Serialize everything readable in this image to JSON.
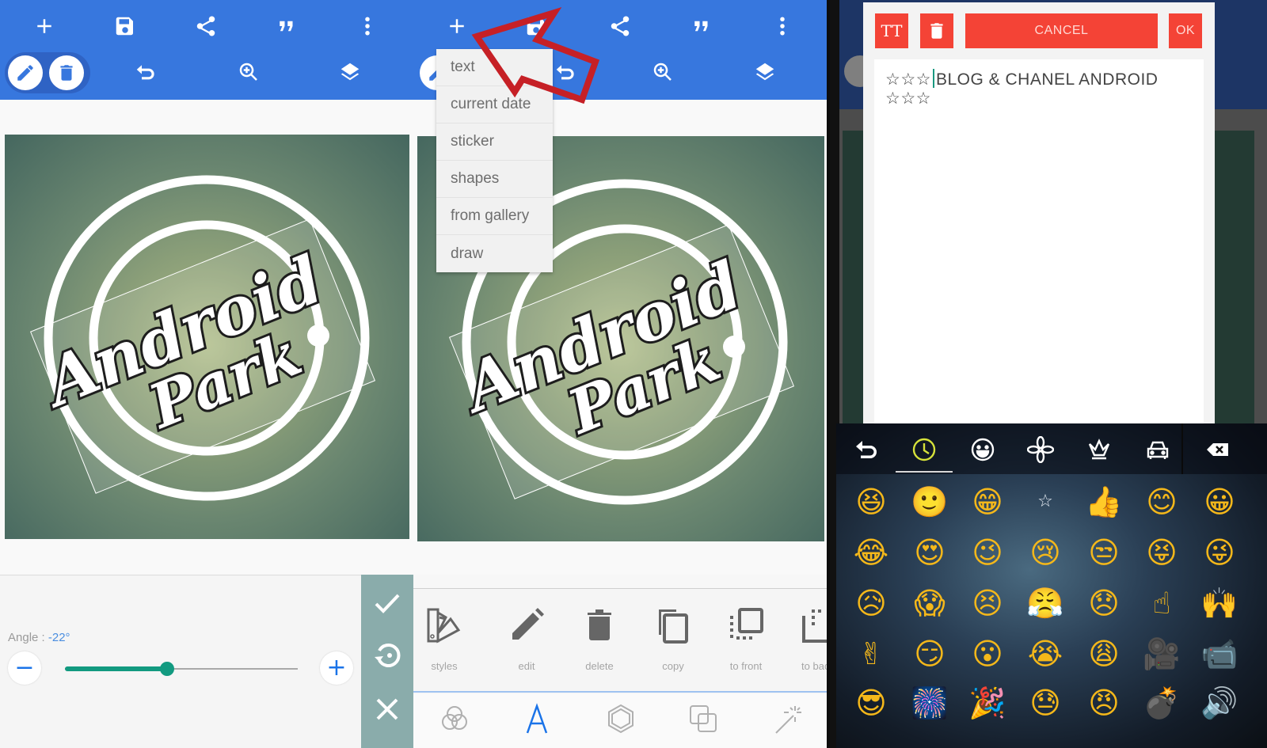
{
  "colors": {
    "appbar": "#3777de",
    "accent_teal": "#129a80",
    "angle_value": "#4a8ee0",
    "dialog_red": "#f44336",
    "action_sidebar": "#8aacab",
    "recent_tab_active": "#d6e23a"
  },
  "panel1": {
    "toolbar_top": [
      {
        "icon": "plus-icon",
        "label": "add"
      },
      {
        "icon": "save-icon",
        "label": "save"
      },
      {
        "icon": "share-icon",
        "label": "share"
      },
      {
        "icon": "quote-icon",
        "label": "quote"
      },
      {
        "icon": "more-vert-icon",
        "label": "more"
      }
    ],
    "toolbar_bottom": [
      {
        "icon": "pencil-icon",
        "label": "edit"
      },
      {
        "icon": "trash-icon",
        "label": "delete"
      },
      {
        "icon": "undo-icon",
        "label": "undo"
      },
      {
        "icon": "zoom-in-icon",
        "label": "zoom"
      },
      {
        "icon": "layers-icon",
        "label": "layers"
      }
    ],
    "canvas": {
      "line1": "Android",
      "line2": "Park"
    },
    "angle": {
      "label": "Angle : ",
      "value_text": "-22°",
      "value": -22,
      "slider_fraction": 0.44
    },
    "side_actions": [
      {
        "icon": "check-icon",
        "label": "apply"
      },
      {
        "icon": "reset-rotation-icon",
        "label": "reset"
      },
      {
        "icon": "close-icon",
        "label": "cancel"
      }
    ]
  },
  "panel2": {
    "add_menu": [
      "text",
      "current date",
      "sticker",
      "shapes",
      "from gallery",
      "draw"
    ],
    "canvas": {
      "line1": "Android",
      "line2": "Park"
    },
    "tools": [
      {
        "icon": "styles-icon",
        "label": "styles"
      },
      {
        "icon": "pencil-icon",
        "label": "edit"
      },
      {
        "icon": "trash-icon",
        "label": "delete"
      },
      {
        "icon": "copy-icon",
        "label": "copy"
      },
      {
        "icon": "bring-to-front-icon",
        "label": "to front"
      },
      {
        "icon": "send-to-back-icon",
        "label": "to back"
      }
    ],
    "bottom_tabs": [
      {
        "icon": "color-circles-icon",
        "label": "colors"
      },
      {
        "icon": "text-a-icon",
        "label": "text",
        "active": true
      },
      {
        "icon": "hexagon-icon",
        "label": "shape"
      },
      {
        "icon": "layers-squares-icon",
        "label": "blend"
      },
      {
        "icon": "magic-wand-icon",
        "label": "effects"
      }
    ]
  },
  "panel3": {
    "dialog": {
      "font_button_label": "TT",
      "cancel_label": "CANCEL",
      "ok_label": "OK",
      "text_prefix": "☆☆☆",
      "text_main": "BLOG & CHANEL ANDROID",
      "text_line2": "☆☆☆"
    },
    "keyboard_tabs": [
      {
        "icon": "back-arrow-icon"
      },
      {
        "icon": "recent-clock-icon",
        "active": true
      },
      {
        "icon": "smiley-icon"
      },
      {
        "icon": "flower-icon"
      },
      {
        "icon": "crown-icon"
      },
      {
        "icon": "car-icon"
      },
      {
        "icon": "backspace-icon"
      }
    ],
    "emoji_rows": [
      [
        "😆",
        "🙂",
        "😁",
        "☆",
        "👍",
        "😊",
        "😀"
      ],
      [
        "😂",
        "😍",
        "😉",
        "😢",
        "😒",
        "😝",
        "😜"
      ],
      [
        "😥",
        "😱",
        "😣",
        "😤",
        "😞",
        "☝",
        "🙌"
      ],
      [
        "✌",
        "😏",
        "😮",
        "😭",
        "😩",
        "🎥",
        "📹"
      ],
      [
        "😎",
        "🎆",
        "🎉",
        "😓",
        "😠",
        "💣",
        "🔊"
      ]
    ]
  }
}
